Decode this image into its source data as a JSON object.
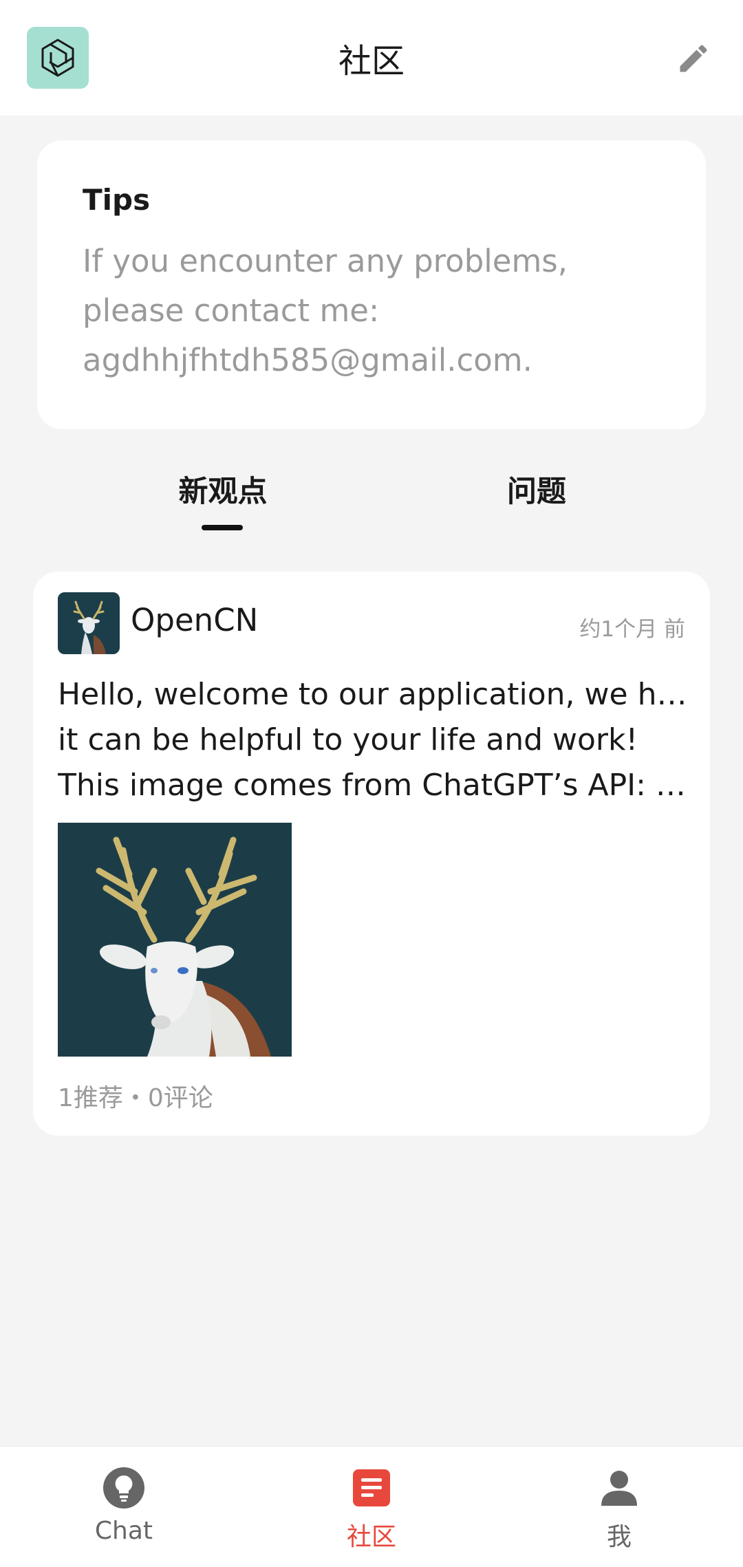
{
  "header": {
    "title": "社区",
    "logo_icon": "app-logo-icon",
    "edit_icon": "pencil-icon"
  },
  "tips": {
    "title": "Tips",
    "lines": [
      "If you encounter any problems,",
      "please contact me:",
      "agdhhjfhtdh585@gmail.com."
    ]
  },
  "tabs": [
    {
      "label": "新观点",
      "active": true
    },
    {
      "label": "问题",
      "active": false
    }
  ],
  "post": {
    "author": "OpenCN",
    "time": "约1个月 前",
    "body_lines": [
      "Hello, welcome to our application, we hope",
      "it can be helpful to your life and work!",
      "This image comes from ChatGPT’s API: C…"
    ],
    "image_icon": "deer-figurine-image",
    "stats": "1推荐・0评论"
  },
  "bottom_nav": {
    "items": [
      {
        "label": "Chat",
        "icon": "lightbulb-icon",
        "active": false
      },
      {
        "label": "社区",
        "icon": "document-icon",
        "active": true
      },
      {
        "label": "我",
        "icon": "person-icon",
        "active": false
      }
    ]
  },
  "colors": {
    "accent": "#e8483c",
    "logo_bg": "#a4dfd2",
    "page_bg": "#f4f4f4",
    "muted_text": "#9a9a9a"
  }
}
